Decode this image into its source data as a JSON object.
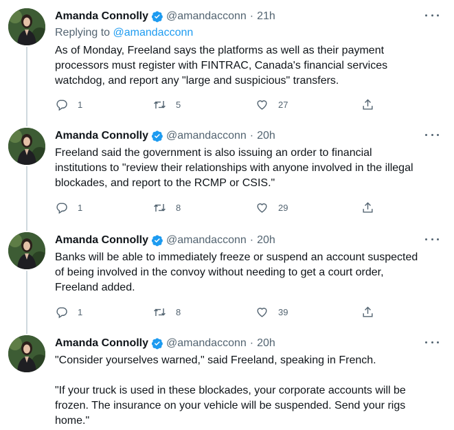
{
  "tweets": [
    {
      "name": "Amanda Connolly",
      "handle": "@amandacconn",
      "time": "21h",
      "replying_label": "Replying to",
      "replying_handle": "@amandacconn",
      "text": "As of Monday, Freeland says the platforms as well as their payment\nprocessors must register with FINTRAC, Canada's financial services\nwatchdog, and report any \"large and suspicious\" transfers.",
      "replies": "1",
      "retweets": "5",
      "likes": "27"
    },
    {
      "name": "Amanda Connolly",
      "handle": "@amandacconn",
      "time": "20h",
      "text": "Freeland said the government is also issuing an order to financial\ninstitutions to \"review their relationships with anyone involved in the illegal\nblockades, and report to the RCMP or CSIS.\"",
      "replies": "1",
      "retweets": "8",
      "likes": "29"
    },
    {
      "name": "Amanda Connolly",
      "handle": "@amandacconn",
      "time": "20h",
      "text": "Banks will be able to immediately freeze or suspend an account suspected\nof being involved in the convoy without needing to get a court order,\nFreeland added.",
      "replies": "1",
      "retweets": "8",
      "likes": "39"
    },
    {
      "name": "Amanda Connolly",
      "handle": "@amandacconn",
      "time": "20h",
      "text": "\"Consider yourselves warned,\" said Freeland, speaking in French.\n\n\"If your truck is used in these blockades, your corporate accounts will be\nfrozen. The insurance on your vehicle will be suspended. Send your rigs\nhome.\""
    }
  ],
  "separator": "·",
  "colors": {
    "accent": "#1d9bf0",
    "muted": "#536471",
    "text": "#0f1419",
    "line": "#cfd9de"
  },
  "icons": {
    "verified": "verified-badge-icon",
    "more": "more-options-icon",
    "reply": "reply-icon",
    "retweet": "retweet-icon",
    "like": "heart-icon",
    "share": "share-icon"
  }
}
